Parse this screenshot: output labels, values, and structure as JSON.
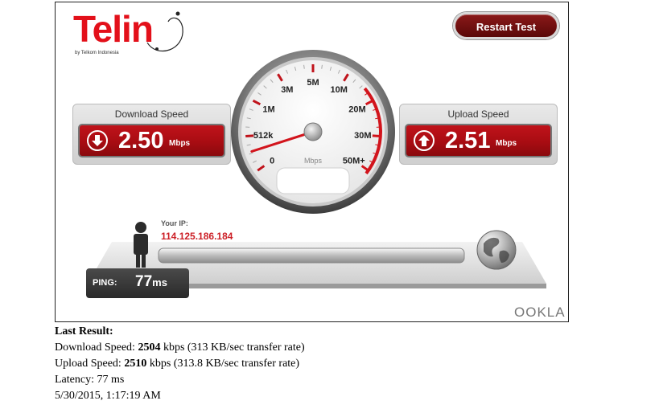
{
  "logo": {
    "word": "Telin",
    "tagline": "by Telkom Indonesia"
  },
  "restart_label": "Restart Test",
  "download": {
    "label": "Download Speed",
    "value": "2.50",
    "unit": "Mbps"
  },
  "upload": {
    "label": "Upload Speed",
    "value": "2.51",
    "unit": "Mbps"
  },
  "gauge": {
    "unit": "Mbps",
    "ticks": [
      "0",
      "512k",
      "1M",
      "3M",
      "5M",
      "10M",
      "20M",
      "30M",
      "50M+"
    ],
    "needle_tick": 0.55
  },
  "ip": {
    "label": "Your IP:",
    "value": "114.125.186.184"
  },
  "ping": {
    "label": "PING:",
    "value": "77",
    "unit": "ms"
  },
  "brand": "OOKLA",
  "result": {
    "title": "Last Result:",
    "download_prefix": "Download Speed: ",
    "download_value": "2504",
    "download_suffix": " kbps (313 KB/sec transfer rate)",
    "upload_prefix": "Upload Speed: ",
    "upload_value": "2510",
    "upload_suffix": " kbps (313.8 KB/sec transfer rate)",
    "latency": "Latency: 77 ms",
    "timestamp": "5/30/2015, 1:17:19 AM"
  },
  "colors": {
    "accent": "#c0131b",
    "button": "#6e1010"
  }
}
